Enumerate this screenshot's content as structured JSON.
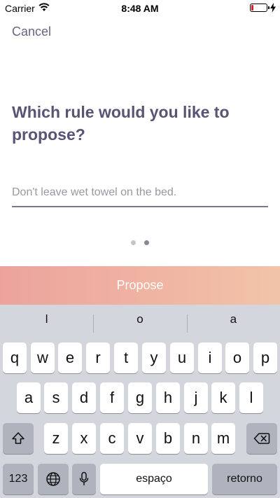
{
  "status_bar": {
    "carrier": "Carrier",
    "time": "8:48 AM"
  },
  "nav": {
    "cancel_label": "Cancel"
  },
  "question": "Which rule would you like to propose?",
  "rule_input": {
    "value": "",
    "placeholder": "Don't leave wet towel on the bed."
  },
  "pager": {
    "total": 2,
    "current": 2
  },
  "propose_label": "Propose",
  "keyboard": {
    "suggestions": [
      "l",
      "o",
      "a"
    ],
    "row1": [
      "q",
      "w",
      "e",
      "r",
      "t",
      "y",
      "u",
      "i",
      "o",
      "p"
    ],
    "row2": [
      "a",
      "s",
      "d",
      "f",
      "g",
      "h",
      "j",
      "k",
      "l"
    ],
    "row3": [
      "z",
      "x",
      "c",
      "v",
      "b",
      "n",
      "m"
    ],
    "numbers_label": "123",
    "space_label": "espaço",
    "return_label": "retorno",
    "icons": {
      "shift": "shift-icon",
      "delete": "backspace-icon",
      "globe": "globe-icon",
      "mic": "microphone-icon"
    }
  },
  "colors": {
    "title": "#5b5375",
    "cancel": "#6a6480",
    "propose_gradient_start": "#eca39c",
    "propose_gradient_end": "#f1c4a8",
    "battery_level": "#e02020"
  }
}
